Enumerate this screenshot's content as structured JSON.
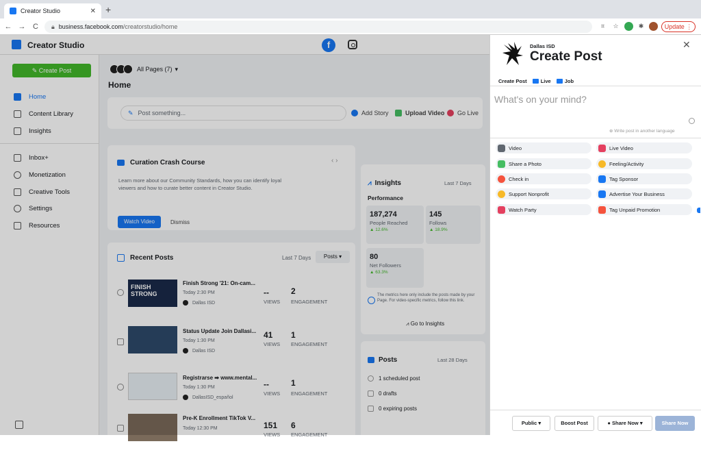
{
  "browser": {
    "tab_title": "Creator Studio",
    "url_host": "business.facebook.com",
    "url_path": "/creatorstudio/home",
    "update_label": "Update"
  },
  "app": {
    "title": "Creator Studio"
  },
  "sidebar": {
    "create_post": "Create Post",
    "items": [
      {
        "label": "Home",
        "icon": "home-icon",
        "active": true
      },
      {
        "label": "Content Library",
        "icon": "library-icon"
      },
      {
        "label": "Insights",
        "icon": "insights-icon"
      },
      {
        "label": "Inbox+",
        "icon": "inbox-icon"
      },
      {
        "label": "Monetization",
        "icon": "dollar-icon"
      },
      {
        "label": "Creative Tools",
        "icon": "tools-icon"
      },
      {
        "label": "Settings",
        "icon": "gear-icon"
      },
      {
        "label": "Resources",
        "icon": "resources-icon"
      }
    ]
  },
  "main": {
    "pages_selector": "All Pages (7)",
    "page_title": "Home",
    "post_placeholder": "Post something...",
    "actions": [
      "Add Story",
      "Upload Video",
      "Go Live"
    ],
    "curation": {
      "title": "Curation Crash Course",
      "desc": "Learn more about our Community Standards, how you can identify loyal viewers and how to curate better content in Creator Studio.",
      "watch": "Watch Video",
      "dismiss": "Dismiss"
    },
    "recent": {
      "title": "Recent Posts",
      "range": "Last 7 Days",
      "filter": "Posts",
      "posts": [
        {
          "title": "Finish Strong '21: On-cam...",
          "time": "Today 2:30 PM",
          "page": "Dallas ISD",
          "views": "--",
          "views_label": "VIEWS",
          "engagement": "2",
          "eng_label": "ENGAGEMENT",
          "thumb_text": "FINISH STRONG"
        },
        {
          "title": "Status Update Join Dallasi...",
          "time": "Today 1:30 PM",
          "page": "Dallas ISD",
          "views": "41",
          "views_label": "VIEWS",
          "engagement": "1",
          "eng_label": "ENGAGEMENT"
        },
        {
          "title": "Registrarse ➡ www.mental...",
          "time": "Today 1:30 PM",
          "page": "DallasISD_español",
          "views": "--",
          "views_label": "VIEWS",
          "engagement": "1",
          "eng_label": "ENGAGEMENT"
        },
        {
          "title": "Pre-K Enrollment TikTok V...",
          "time": "Today 12:30 PM",
          "page": "",
          "views": "151",
          "views_label": "VIEWS",
          "engagement": "6",
          "eng_label": "ENGAGEMENT"
        }
      ]
    },
    "insights": {
      "title": "Insights",
      "range": "Last 7 Days",
      "performance": "Performance",
      "metrics": [
        {
          "value": "187,274",
          "label": "People Reached",
          "change": "▲ 12.6%"
        },
        {
          "value": "145",
          "label": "Follows",
          "change": "▲ 18.9%"
        },
        {
          "value": "80",
          "label": "Net Followers",
          "change": "▲ 63.3%"
        }
      ],
      "note": "The metrics here only include the posts made by your Page. For video-specific metrics, follow this link.",
      "go": "Go to Insights"
    },
    "posts": {
      "title": "Posts",
      "range": "Last 28 Days",
      "lines": [
        "1 scheduled post",
        "0 drafts",
        "0 expiring posts"
      ]
    }
  },
  "panel": {
    "page_name": "Dallas ISD",
    "title": "Create Post",
    "tabs": [
      "Create Post",
      "Live",
      "Job"
    ],
    "placeholder": "What's on your mind?",
    "translate": "Write post in another language",
    "options": [
      {
        "label": "Video",
        "color": "#606770"
      },
      {
        "label": "Live Video",
        "color": "#e4405f"
      },
      {
        "label": "Share a Photo",
        "color": "#45bd62"
      },
      {
        "label": "Feeling/Activity",
        "color": "#f7b928"
      },
      {
        "label": "Check in",
        "color": "#f5533d"
      },
      {
        "label": "Tag Sponsor",
        "color": "#1877f2"
      },
      {
        "label": "Support Nonprofit",
        "color": "#f7b928"
      },
      {
        "label": "Advertise Your Business",
        "color": "#1877f2"
      },
      {
        "label": "Watch Party",
        "color": "#e4405f"
      },
      {
        "label": "Tag Unpaid Promotion",
        "color": "#f5533d"
      }
    ],
    "footer": {
      "public": "Public",
      "boost": "Boost Post",
      "share_now_dd": "Share Now",
      "share_now": "Share Now"
    }
  }
}
